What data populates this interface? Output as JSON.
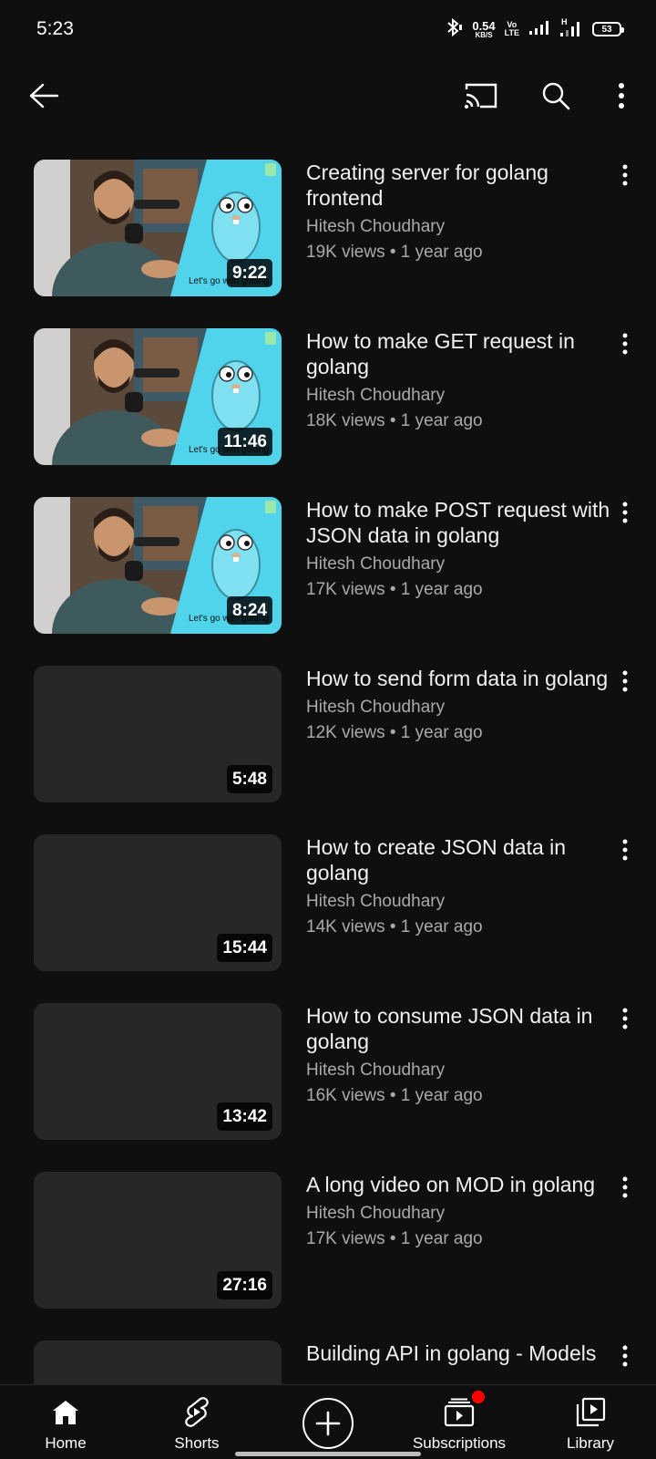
{
  "status_bar": {
    "time": "5:23",
    "net_speed": "0.54",
    "net_unit": "KB/S",
    "volte_top": "Vo",
    "volte_bottom": "LTE",
    "battery": "53"
  },
  "app_bar": {
    "icons": [
      "back-arrow-icon",
      "cast-icon",
      "search-icon",
      "more-vert-icon"
    ]
  },
  "videos": [
    {
      "title": "Creating server for golang frontend",
      "channel": "Hitesh Choudhary",
      "stats": "19K views • 1 year ago",
      "duration": "9:22",
      "thumb_text": "Let's go with golang",
      "has_art": true
    },
    {
      "title": "How to make GET request in golang",
      "channel": "Hitesh Choudhary",
      "stats": "18K views • 1 year ago",
      "duration": "11:46",
      "thumb_text": "Let's go with golang",
      "has_art": true
    },
    {
      "title": "How to make POST request with JSON data in golang",
      "channel": "Hitesh Choudhary",
      "stats": "17K views • 1 year ago",
      "duration": "8:24",
      "thumb_text": "Let's go with golang",
      "has_art": true
    },
    {
      "title": "How to send form data in golang",
      "channel": "Hitesh Choudhary",
      "stats": "12K views • 1 year ago",
      "duration": "5:48",
      "has_art": false
    },
    {
      "title": "How to create JSON data in golang",
      "channel": "Hitesh Choudhary",
      "stats": "14K views • 1 year ago",
      "duration": "15:44",
      "has_art": false
    },
    {
      "title": "How to consume JSON data in golang",
      "channel": "Hitesh Choudhary",
      "stats": "16K views • 1 year ago",
      "duration": "13:42",
      "has_art": false
    },
    {
      "title": "A long video on MOD in golang",
      "channel": "Hitesh Choudhary",
      "stats": "17K views • 1 year ago",
      "duration": "27:16",
      "has_art": false
    },
    {
      "title": "Building API in golang - Models",
      "channel": "",
      "stats": "",
      "duration": "",
      "has_art": false
    }
  ],
  "bottom_nav": {
    "items": [
      {
        "label": "Home",
        "icon": "home-icon",
        "active": true
      },
      {
        "label": "Shorts",
        "icon": "shorts-icon"
      },
      {
        "label": "",
        "icon": "create-plus-icon"
      },
      {
        "label": "Subscriptions",
        "icon": "subscriptions-icon",
        "badge": true
      },
      {
        "label": "Library",
        "icon": "library-icon"
      }
    ]
  },
  "colors": {
    "background": "#0f0f0f",
    "text_primary": "#f1f1f1",
    "text_secondary": "#aaaaaa",
    "thumb_placeholder": "#272727",
    "notification": "#ff0000"
  }
}
